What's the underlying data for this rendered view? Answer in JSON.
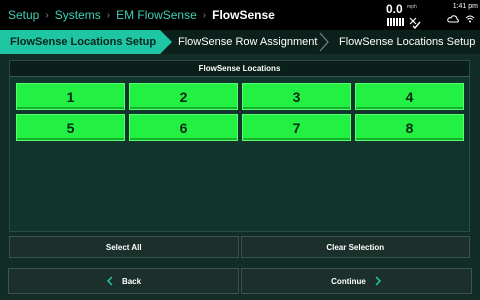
{
  "breadcrumb": [
    {
      "label": "Setup",
      "current": false
    },
    {
      "label": "Systems",
      "current": false
    },
    {
      "label": "EM FlowSense",
      "current": false
    },
    {
      "label": "FlowSense",
      "current": true
    }
  ],
  "status": {
    "speed_value": "0.0",
    "speed_unit": "mph",
    "time": "1:41 pm",
    "icons": [
      "gps-signal-icon",
      "gps-check-icon",
      "cloud-icon",
      "wifi-icon"
    ]
  },
  "tabs": [
    {
      "label": "FlowSense Locations Setup",
      "active": true
    },
    {
      "label": "FlowSense Row Assignment",
      "active": false
    },
    {
      "label": "FlowSense Locations Setup",
      "active": false
    }
  ],
  "locations": {
    "title": "FlowSense Locations",
    "items": [
      "1",
      "2",
      "3",
      "4",
      "5",
      "6",
      "7",
      "8"
    ]
  },
  "actions": {
    "select_all": "Select All",
    "clear_selection": "Clear Selection"
  },
  "navigation": {
    "back": "Back",
    "continue": "Continue"
  },
  "colors": {
    "accent": "#1ec6a4",
    "location_selected": "#22f042",
    "background": "#122d26",
    "chevron": "#1ec6a4"
  }
}
